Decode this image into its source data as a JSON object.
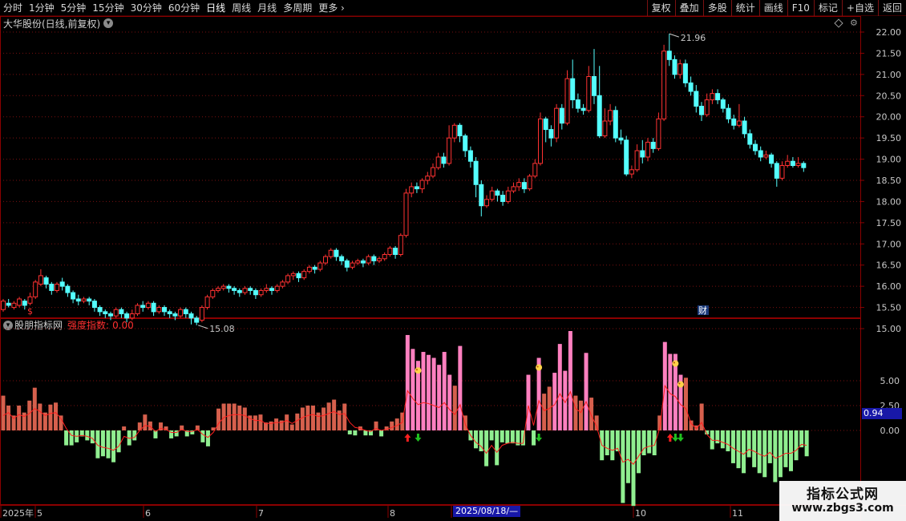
{
  "toolbar": {
    "periods": [
      "分时",
      "1分钟",
      "5分钟",
      "15分钟",
      "30分钟",
      "60分钟",
      "日线",
      "周线",
      "月线",
      "多周期"
    ],
    "more": "更多",
    "active_period": "日线",
    "right_items": [
      "复权",
      "叠加",
      "多股",
      "统计",
      "画线",
      "F10",
      "标记",
      "+自选",
      "返回"
    ]
  },
  "stock": {
    "title": "大华股份(日线,前复权)"
  },
  "indicator": {
    "source": "股朋指标网",
    "name": "强度指数:",
    "value": "0.00",
    "current_badge": "0.94"
  },
  "price_axis": {
    "ticks": [
      "22.00",
      "21.50",
      "21.00",
      "20.50",
      "20.00",
      "19.50",
      "19.00",
      "18.50",
      "18.00",
      "17.50",
      "17.00",
      "16.50",
      "16.00",
      "15.50",
      "15.00"
    ]
  },
  "indicator_axis": {
    "ticks": [
      "5.00",
      "2.50",
      "0.00"
    ]
  },
  "time_axis": {
    "labels": [
      "2025年",
      "5",
      "6",
      "7",
      "8",
      "9",
      "10",
      "11"
    ],
    "crosshair_date": "2025/08/18/—"
  },
  "annotations": {
    "high": "21.96",
    "low": "15.08",
    "s_marker": "$",
    "cai_marker": "财"
  },
  "watermark": {
    "title": "指标公式网",
    "url": "www.zbgs3.com"
  },
  "colors": {
    "up": "#ff3232",
    "down": "#54ffff",
    "pos_bar": "#d6604d",
    "pos_bar_strong": "#ff80c0",
    "neg_bar": "#90ee90",
    "line": "#ff2020"
  },
  "chart_data": {
    "type": "candlestick",
    "title": "大华股份(日线,前复权)",
    "ylim": [
      14.9,
      22.15
    ],
    "high": 21.96,
    "low": 15.08,
    "candles": [
      [
        15.45,
        15.65,
        15.4,
        15.7
      ],
      [
        15.6,
        15.55,
        15.5,
        15.7
      ],
      [
        15.5,
        15.6,
        15.45,
        15.65
      ],
      [
        15.55,
        15.7,
        15.5,
        15.75
      ],
      [
        15.65,
        15.55,
        15.45,
        15.7
      ],
      [
        15.6,
        15.75,
        15.55,
        15.85
      ],
      [
        15.75,
        16.1,
        15.7,
        16.15
      ],
      [
        16.05,
        16.25,
        16.0,
        16.4
      ],
      [
        16.2,
        16.05,
        15.95,
        16.25
      ],
      [
        16.05,
        15.9,
        15.8,
        16.1
      ],
      [
        15.9,
        16.05,
        15.85,
        16.1
      ],
      [
        16.1,
        16.0,
        15.9,
        16.2
      ],
      [
        16.0,
        15.85,
        15.75,
        16.05
      ],
      [
        15.85,
        15.7,
        15.6,
        15.9
      ],
      [
        15.7,
        15.65,
        15.55,
        15.8
      ],
      [
        15.65,
        15.7,
        15.6,
        15.75
      ],
      [
        15.7,
        15.65,
        15.55,
        15.75
      ],
      [
        15.65,
        15.5,
        15.4,
        15.7
      ],
      [
        15.5,
        15.4,
        15.3,
        15.55
      ],
      [
        15.4,
        15.35,
        15.25,
        15.45
      ],
      [
        15.35,
        15.3,
        15.2,
        15.4
      ],
      [
        15.3,
        15.45,
        15.25,
        15.5
      ],
      [
        15.45,
        15.35,
        15.25,
        15.5
      ],
      [
        15.35,
        15.25,
        15.15,
        15.4
      ],
      [
        15.25,
        15.35,
        15.2,
        15.45
      ],
      [
        15.35,
        15.55,
        15.3,
        15.6
      ],
      [
        15.55,
        15.5,
        15.4,
        15.65
      ],
      [
        15.5,
        15.6,
        15.45,
        15.65
      ],
      [
        15.6,
        15.4,
        15.3,
        15.65
      ],
      [
        15.4,
        15.5,
        15.35,
        15.55
      ],
      [
        15.5,
        15.4,
        15.3,
        15.55
      ],
      [
        15.4,
        15.35,
        15.25,
        15.45
      ],
      [
        15.35,
        15.3,
        15.2,
        15.4
      ],
      [
        15.3,
        15.45,
        15.25,
        15.5
      ],
      [
        15.45,
        15.35,
        15.25,
        15.5
      ],
      [
        15.35,
        15.25,
        15.1,
        15.4
      ],
      [
        15.25,
        15.15,
        15.08,
        15.3
      ],
      [
        15.2,
        15.5,
        15.15,
        15.55
      ],
      [
        15.5,
        15.75,
        15.45,
        15.8
      ],
      [
        15.75,
        15.9,
        15.7,
        15.95
      ],
      [
        15.9,
        15.95,
        15.85,
        16.0
      ],
      [
        15.95,
        16.0,
        15.9,
        16.05
      ],
      [
        16.0,
        15.95,
        15.85,
        16.05
      ],
      [
        15.95,
        15.9,
        15.8,
        16.0
      ],
      [
        15.9,
        15.85,
        15.75,
        15.95
      ],
      [
        15.85,
        15.95,
        15.8,
        16.0
      ],
      [
        15.95,
        15.9,
        15.8,
        16.0
      ],
      [
        15.9,
        15.8,
        15.7,
        15.95
      ],
      [
        15.8,
        15.9,
        15.75,
        15.95
      ],
      [
        15.9,
        15.95,
        15.85,
        16.05
      ],
      [
        15.95,
        15.9,
        15.8,
        16.0
      ],
      [
        15.9,
        16.0,
        15.85,
        16.05
      ],
      [
        16.0,
        16.1,
        15.95,
        16.15
      ],
      [
        16.1,
        16.25,
        16.05,
        16.3
      ],
      [
        16.25,
        16.3,
        16.15,
        16.35
      ],
      [
        16.3,
        16.2,
        16.1,
        16.35
      ],
      [
        16.2,
        16.35,
        16.15,
        16.4
      ],
      [
        16.35,
        16.45,
        16.3,
        16.5
      ],
      [
        16.45,
        16.4,
        16.3,
        16.5
      ],
      [
        16.4,
        16.55,
        16.35,
        16.6
      ],
      [
        16.55,
        16.7,
        16.5,
        16.75
      ],
      [
        16.7,
        16.85,
        16.65,
        16.9
      ],
      [
        16.85,
        16.7,
        16.6,
        16.9
      ],
      [
        16.7,
        16.6,
        16.5,
        16.75
      ],
      [
        16.6,
        16.45,
        16.35,
        16.65
      ],
      [
        16.45,
        16.55,
        16.4,
        16.6
      ],
      [
        16.55,
        16.6,
        16.5,
        16.65
      ],
      [
        16.6,
        16.55,
        16.45,
        16.65
      ],
      [
        16.55,
        16.7,
        16.5,
        16.75
      ],
      [
        16.7,
        16.6,
        16.5,
        16.75
      ],
      [
        16.6,
        16.65,
        16.55,
        16.7
      ],
      [
        16.65,
        16.75,
        16.6,
        16.8
      ],
      [
        16.75,
        16.9,
        16.7,
        16.95
      ],
      [
        16.9,
        16.75,
        16.65,
        16.95
      ],
      [
        16.75,
        17.2,
        16.7,
        17.25
      ],
      [
        17.2,
        18.2,
        17.15,
        18.3
      ],
      [
        18.2,
        18.35,
        18.1,
        18.45
      ],
      [
        18.35,
        18.3,
        18.2,
        18.45
      ],
      [
        18.3,
        18.5,
        18.2,
        18.55
      ],
      [
        18.5,
        18.6,
        18.4,
        18.7
      ],
      [
        18.6,
        18.8,
        18.55,
        18.9
      ],
      [
        18.8,
        19.05,
        18.75,
        19.15
      ],
      [
        19.05,
        18.9,
        18.8,
        19.15
      ],
      [
        18.9,
        19.5,
        18.85,
        19.8
      ],
      [
        19.5,
        19.8,
        19.4,
        19.85
      ],
      [
        19.8,
        19.55,
        19.4,
        19.85
      ],
      [
        19.55,
        19.2,
        19.05,
        19.6
      ],
      [
        19.2,
        18.95,
        18.8,
        19.3
      ],
      [
        18.95,
        18.4,
        18.1,
        19.05
      ],
      [
        18.4,
        17.9,
        17.65,
        18.5
      ],
      [
        17.9,
        18.05,
        17.85,
        18.15
      ],
      [
        18.05,
        18.25,
        18.0,
        18.35
      ],
      [
        18.25,
        18.15,
        18.0,
        18.3
      ],
      [
        18.15,
        18.0,
        17.9,
        18.25
      ],
      [
        18.0,
        18.25,
        17.95,
        18.35
      ],
      [
        18.25,
        18.35,
        18.2,
        18.45
      ],
      [
        18.35,
        18.45,
        18.25,
        18.55
      ],
      [
        18.45,
        18.3,
        18.2,
        18.55
      ],
      [
        18.3,
        18.6,
        18.25,
        18.65
      ],
      [
        18.6,
        18.9,
        18.55,
        19.0
      ],
      [
        18.9,
        19.95,
        18.85,
        20.1
      ],
      [
        19.95,
        19.7,
        19.4,
        20.0
      ],
      [
        19.7,
        19.5,
        19.3,
        19.8
      ],
      [
        19.5,
        20.2,
        19.4,
        20.3
      ],
      [
        20.2,
        19.85,
        19.7,
        20.3
      ],
      [
        19.85,
        20.9,
        19.8,
        21.1
      ],
      [
        20.9,
        20.4,
        20.2,
        21.35
      ],
      [
        20.4,
        20.2,
        20.1,
        20.55
      ],
      [
        20.2,
        20.15,
        20.05,
        20.3
      ],
      [
        20.15,
        20.95,
        20.1,
        21.2
      ],
      [
        20.95,
        20.5,
        20.3,
        21.6
      ],
      [
        20.5,
        19.55,
        19.5,
        21.2
      ],
      [
        19.55,
        19.9,
        19.5,
        20.2
      ],
      [
        19.9,
        20.15,
        19.8,
        20.3
      ],
      [
        20.15,
        19.5,
        19.4,
        20.25
      ],
      [
        19.5,
        19.45,
        19.35,
        19.7
      ],
      [
        19.45,
        18.65,
        18.6,
        19.55
      ],
      [
        18.65,
        18.75,
        18.55,
        18.85
      ],
      [
        18.75,
        19.2,
        18.7,
        19.35
      ],
      [
        19.2,
        19.05,
        18.9,
        19.45
      ],
      [
        19.05,
        19.4,
        18.95,
        19.5
      ],
      [
        19.4,
        19.25,
        19.15,
        19.5
      ],
      [
        19.25,
        19.95,
        19.2,
        20.1
      ],
      [
        19.95,
        21.55,
        19.9,
        21.7
      ],
      [
        21.55,
        21.35,
        21.2,
        21.96
      ],
      [
        21.35,
        21.0,
        20.9,
        21.45
      ],
      [
        21.0,
        21.25,
        20.9,
        21.35
      ],
      [
        21.25,
        20.8,
        20.7,
        21.35
      ],
      [
        20.8,
        20.6,
        20.5,
        20.95
      ],
      [
        20.6,
        20.25,
        20.1,
        20.75
      ],
      [
        20.25,
        20.05,
        19.9,
        20.35
      ],
      [
        20.05,
        20.4,
        20.0,
        20.55
      ],
      [
        20.4,
        20.55,
        20.3,
        20.65
      ],
      [
        20.55,
        20.4,
        20.3,
        20.65
      ],
      [
        20.4,
        20.2,
        20.1,
        20.45
      ],
      [
        20.2,
        19.95,
        19.85,
        20.3
      ],
      [
        19.95,
        19.8,
        19.7,
        20.05
      ],
      [
        19.8,
        19.9,
        19.75,
        20.3
      ],
      [
        19.9,
        19.6,
        19.5,
        20.0
      ],
      [
        19.6,
        19.35,
        19.25,
        19.7
      ],
      [
        19.35,
        19.2,
        19.1,
        19.45
      ],
      [
        19.2,
        19.05,
        18.95,
        19.3
      ],
      [
        19.05,
        19.1,
        19.0,
        19.2
      ],
      [
        19.1,
        18.9,
        18.8,
        19.15
      ],
      [
        18.9,
        18.55,
        18.35,
        18.95
      ],
      [
        18.55,
        18.85,
        18.5,
        18.95
      ],
      [
        18.85,
        18.95,
        18.8,
        19.1
      ],
      [
        18.95,
        18.85,
        18.8,
        19.05
      ],
      [
        18.85,
        18.9,
        18.8,
        19.05
      ],
      [
        18.9,
        18.8,
        18.7,
        18.95
      ]
    ],
    "indicator": {
      "name": "强度指数",
      "ylim": [
        -9.5,
        12.5
      ],
      "bars": [
        3.5,
        2.5,
        1.5,
        2.5,
        1.8,
        3.0,
        4.3,
        2.7,
        1.8,
        2.6,
        2.8,
        1.5,
        -1.5,
        -1.5,
        -1.2,
        -0.6,
        -1.0,
        -1.3,
        -2.8,
        -2.6,
        -2.8,
        -3.2,
        -2.2,
        0.4,
        -1.5,
        -1.0,
        0.8,
        1.6,
        0.9,
        -0.8,
        0.8,
        0.4,
        -0.8,
        -0.6,
        0.5,
        -0.6,
        -0.4,
        0.5,
        -1.2,
        -1.6,
        0.3,
        2.2,
        2.7,
        2.7,
        2.7,
        2.5,
        2.3,
        1.5,
        1.5,
        1.6,
        0.8,
        0.9,
        1.2,
        1.0,
        1.6,
        0.6,
        1.7,
        2.3,
        2.5,
        2.5,
        1.8,
        2.3,
        2.8,
        3.1,
        2.0,
        2.7,
        -0.4,
        -0.5,
        0.4,
        -0.5,
        -0.5,
        0.9,
        -0.6,
        0.4,
        0.9,
        1.2,
        1.8,
        9.6,
        8.2,
        7.0,
        7.9,
        7.6,
        7.3,
        6.6,
        7.9,
        5.6,
        4.5,
        8.5,
        1.5,
        -1.0,
        -1.8,
        -2.1,
        -3.6,
        -1.0,
        -3.5,
        -1.2,
        -1.3,
        -1.3,
        -1.5,
        -1.5,
        5.6,
        -1.5,
        7.3,
        3.7,
        4.4,
        5.8,
        8.7,
        6.0,
        10.0,
        3.5,
        3.0,
        7.8,
        3.3,
        1.5,
        -3.0,
        -2.5,
        -3.0,
        -2.1,
        -7.3,
        -5.3,
        -7.6,
        -4.3,
        -2.5,
        -2.3,
        -2.5,
        1.5,
        8.9,
        7.7,
        7.7,
        5.6,
        5.3,
        1.0,
        0.5,
        2.7,
        -0.4,
        -1.9,
        -1.3,
        -1.8,
        -2.1,
        -3.3,
        -3.8,
        -4.3,
        -2.7,
        -3.7,
        -4.3,
        -4.7,
        -3.3,
        -5.2,
        -4.7,
        -3.7,
        -4.1,
        -3.0,
        -1.7,
        -2.6
      ],
      "strong_threshold": 5.5,
      "line": [
        1.5,
        1.8,
        1.2,
        1.6,
        1.4,
        1.7,
        2.2,
        1.9,
        1.5,
        1.7,
        1.8,
        1.2,
        0.2,
        -0.5,
        -0.6,
        -0.5,
        -0.6,
        -0.8,
        -1.5,
        -1.7,
        -1.8,
        -2.0,
        -1.6,
        -0.6,
        -0.8,
        -0.7,
        0.0,
        0.5,
        0.4,
        -0.1,
        0.2,
        0.1,
        -0.2,
        -0.2,
        0.1,
        -0.1,
        -0.1,
        0.1,
        -0.4,
        -0.7,
        -0.2,
        0.7,
        1.3,
        1.5,
        1.6,
        1.6,
        1.5,
        1.2,
        1.0,
        1.0,
        0.7,
        0.7,
        0.8,
        0.8,
        1.0,
        0.7,
        1.0,
        1.3,
        1.5,
        1.6,
        1.4,
        1.5,
        1.7,
        1.9,
        1.6,
        1.7,
        0.8,
        0.3,
        0.2,
        0.0,
        -0.1,
        0.2,
        0.0,
        0.1,
        0.3,
        0.5,
        0.8,
        4.0,
        3.2,
        2.6,
        2.8,
        2.7,
        2.5,
        2.3,
        2.8,
        2.1,
        1.6,
        2.6,
        0.6,
        -0.5,
        -1.2,
        -1.6,
        -2.3,
        -1.5,
        -2.2,
        -1.5,
        -1.3,
        -1.2,
        -1.3,
        -1.3,
        2.5,
        0.5,
        3.0,
        2.0,
        2.2,
        2.6,
        3.7,
        2.8,
        3.9,
        2.2,
        1.8,
        2.9,
        1.5,
        0.4,
        -1.5,
        -1.8,
        -2.0,
        -1.8,
        -3.2,
        -2.9,
        -3.4,
        -2.6,
        -1.8,
        -1.6,
        -1.5,
        0.2,
        4.5,
        3.7,
        3.4,
        2.6,
        2.2,
        0.7,
        0.2,
        0.8,
        -0.4,
        -1.0,
        -1.0,
        -1.2,
        -1.4,
        -1.8,
        -2.1,
        -2.4,
        -1.9,
        -2.1,
        -2.4,
        -2.6,
        -2.2,
        -2.8,
        -2.6,
        -2.3,
        -2.3,
        -2.0,
        -1.4,
        -1.5
      ],
      "buy_arrows": [
        77,
        127
      ],
      "sell_arrows": [
        79,
        102,
        128,
        129
      ],
      "star_markers": [
        79,
        102,
        128,
        129
      ]
    }
  }
}
